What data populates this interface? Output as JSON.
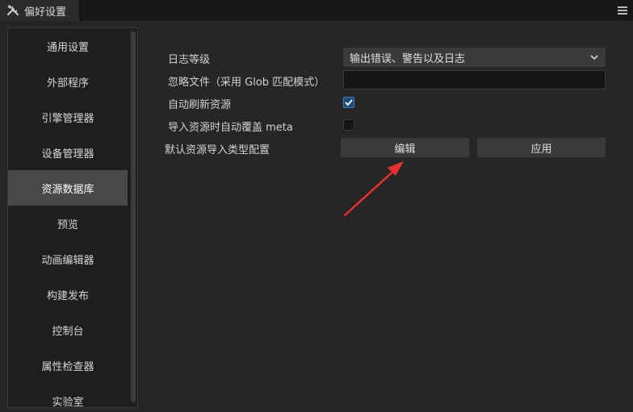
{
  "window": {
    "tab_title": "偏好设置",
    "tab_icon": "tools-icon",
    "menu_icon": "hamburger-menu-icon"
  },
  "sidebar": {
    "items": [
      {
        "label": "通用设置",
        "active": false
      },
      {
        "label": "外部程序",
        "active": false
      },
      {
        "label": "引擎管理器",
        "active": false
      },
      {
        "label": "设备管理器",
        "active": false
      },
      {
        "label": "资源数据库",
        "active": true
      },
      {
        "label": "预览",
        "active": false
      },
      {
        "label": "动画编辑器",
        "active": false
      },
      {
        "label": "构建发布",
        "active": false
      },
      {
        "label": "控制台",
        "active": false
      },
      {
        "label": "属性检查器",
        "active": false
      },
      {
        "label": "实验室",
        "active": false
      }
    ]
  },
  "settings": {
    "log_level": {
      "label": "日志等级",
      "value": "输出错误、警告以及日志"
    },
    "ignore_files": {
      "label": "忽略文件（采用 Glob 匹配模式）",
      "value": ""
    },
    "auto_refresh": {
      "label": "自动刷新资源",
      "checked": true
    },
    "auto_overwrite_meta": {
      "label": "导入资源时自动覆盖 meta",
      "checked": false
    },
    "default_import_config": {
      "label": "默认资源导入类型配置",
      "edit_button": "编辑",
      "apply_button": "应用"
    }
  },
  "colors": {
    "accent_check": "#1e4a77",
    "annotation_arrow": "#e8312f",
    "active_item_bg": "#484848"
  }
}
